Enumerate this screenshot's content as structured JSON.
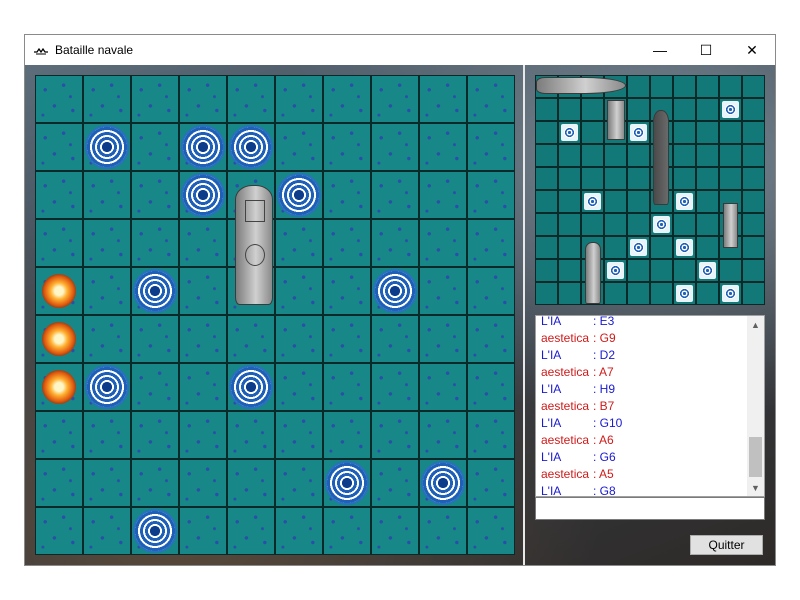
{
  "window": {
    "title": "Bataille navale",
    "minimize_glyph": "—",
    "maximize_glyph": "☐",
    "close_glyph": "✕"
  },
  "player_board": {
    "rows": 10,
    "cols": 10,
    "whirlpools": [
      [
        1,
        1
      ],
      [
        1,
        3
      ],
      [
        1,
        4
      ],
      [
        2,
        3
      ],
      [
        2,
        5
      ],
      [
        4,
        2
      ],
      [
        4,
        7
      ],
      [
        6,
        1
      ],
      [
        6,
        4
      ],
      [
        8,
        6
      ],
      [
        8,
        8
      ],
      [
        9,
        2
      ]
    ],
    "explosions": [
      [
        4,
        0
      ],
      [
        5,
        0
      ],
      [
        6,
        0
      ]
    ]
  },
  "enemy_board": {
    "rows": 10,
    "cols": 10,
    "whirlpools": [
      [
        1,
        8
      ],
      [
        2,
        1
      ],
      [
        2,
        4
      ],
      [
        5,
        2
      ],
      [
        5,
        6
      ],
      [
        6,
        5
      ],
      [
        7,
        4
      ],
      [
        7,
        6
      ],
      [
        8,
        3
      ],
      [
        8,
        7
      ],
      [
        9,
        6
      ],
      [
        9,
        8
      ]
    ]
  },
  "log": {
    "entries": [
      {
        "name": "L'IA",
        "sep": ": ",
        "move": "E3",
        "player": "ai"
      },
      {
        "name": "aestetica",
        "sep": ": ",
        "move": "G9",
        "player": "user"
      },
      {
        "name": "L'IA",
        "sep": ": ",
        "move": "D2",
        "player": "ai"
      },
      {
        "name": "aestetica",
        "sep": ": ",
        "move": "A7",
        "player": "user"
      },
      {
        "name": "L'IA",
        "sep": ": ",
        "move": "H9",
        "player": "ai"
      },
      {
        "name": "aestetica",
        "sep": ": ",
        "move": "B7",
        "player": "user"
      },
      {
        "name": "L'IA",
        "sep": ": ",
        "move": "G10",
        "player": "ai"
      },
      {
        "name": "aestetica",
        "sep": ": ",
        "move": "A6",
        "player": "user"
      },
      {
        "name": "L'IA",
        "sep": ": ",
        "move": "G6",
        "player": "ai"
      },
      {
        "name": "aestetica",
        "sep": ": ",
        "move": "A5",
        "player": "user"
      },
      {
        "name": "L'IA",
        "sep": ": ",
        "move": "G8",
        "player": "ai"
      }
    ],
    "colors": {
      "ai": "#1a1ad0",
      "user": "#d01a1a"
    }
  },
  "chat_input": {
    "value": ""
  },
  "quit_button": {
    "label": "Quitter"
  },
  "colors": {
    "water": "#178787",
    "grid_line": "#0a2a2a",
    "divider": "#e8e8e8"
  },
  "icons": {
    "whirlpool": "whirlpool-icon",
    "explosion": "explosion-icon",
    "ship": "ship-icon"
  }
}
